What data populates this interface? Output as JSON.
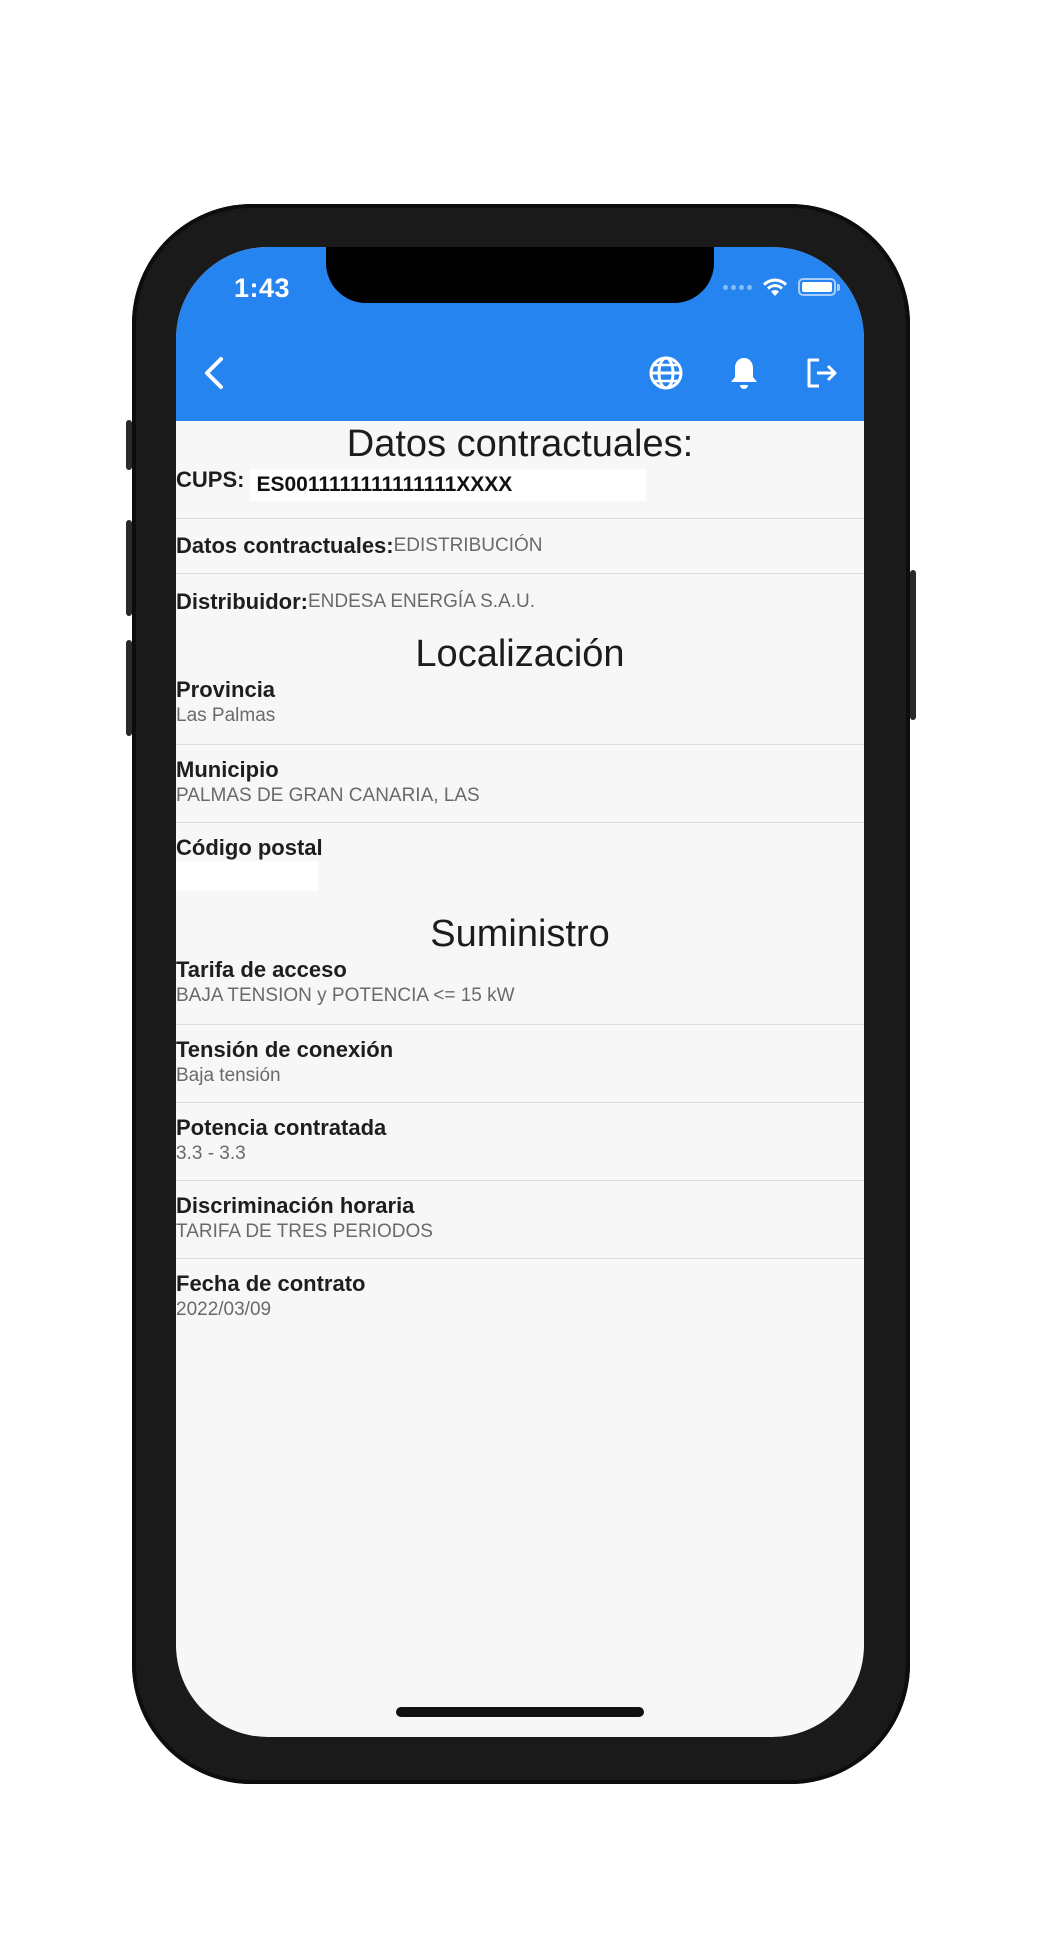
{
  "status_bar": {
    "time": "1:43"
  },
  "toolbar": {
    "back_icon": "chevron-left-icon",
    "globe_icon": "globe-icon",
    "bell_icon": "bell-icon",
    "logout_icon": "logout-icon",
    "color": "#2584f0"
  },
  "contract": {
    "title": "Datos contractuales:",
    "cups_label": "CUPS:",
    "cups_value": "ES0011111111111111XXXX",
    "datos_label": "Datos contractuales:",
    "datos_value": "EDISTRIBUCIÓN",
    "distribuidor_label": "Distribuidor:",
    "distribuidor_value": "ENDESA ENERGÍA S.A.U."
  },
  "location": {
    "title": "Localización",
    "items": [
      {
        "label": "Provincia",
        "value": "Las Palmas"
      },
      {
        "label": "Municipio",
        "value": "PALMAS DE GRAN CANARIA, LAS"
      },
      {
        "label": "Código postal",
        "value": ""
      }
    ]
  },
  "supply": {
    "title": "Suministro",
    "items": [
      {
        "label": "Tarifa de acceso",
        "value": "BAJA TENSION y POTENCIA <= 15 kW"
      },
      {
        "label": "Tensión de conexión",
        "value": "Baja tensión"
      },
      {
        "label": "Potencia contratada",
        "value": "3.3 - 3.3"
      },
      {
        "label": "Discriminación horaria",
        "value": "TARIFA DE TRES PERIODOS"
      },
      {
        "label": "Fecha de contrato",
        "value": "2022/03/09"
      }
    ]
  }
}
